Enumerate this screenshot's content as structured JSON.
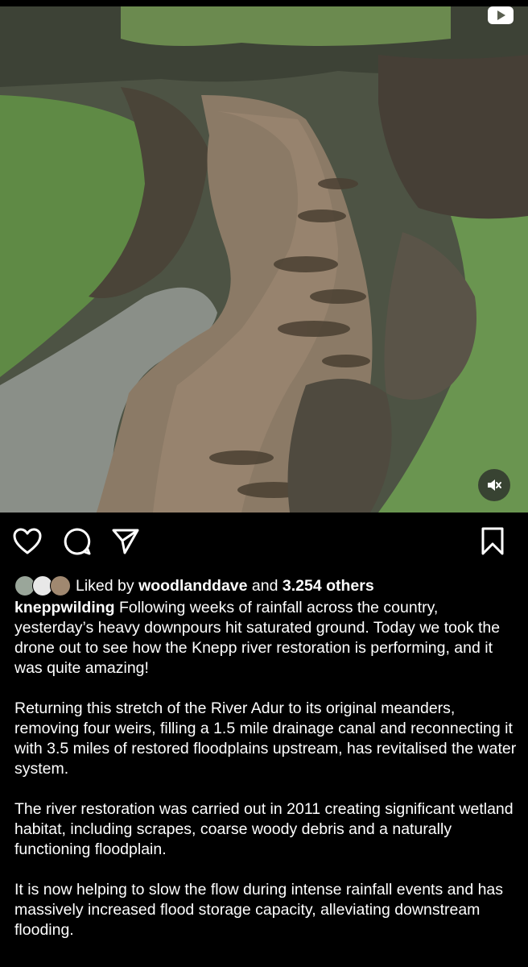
{
  "post": {
    "media": {
      "description_icon": "aerial-flood-photo",
      "video_icon": "video-camera-icon",
      "mute_icon": "speaker-muted-icon"
    },
    "actions": {
      "like_icon": "heart-icon",
      "comment_icon": "comment-icon",
      "share_icon": "send-icon",
      "save_icon": "bookmark-icon"
    },
    "likes": {
      "prefix": "Liked by",
      "user": "woodlanddave",
      "conjunction": "and",
      "others": "3.254 others"
    },
    "caption": {
      "username": "kneppwilding",
      "paragraph_1": "Following weeks of rainfall across the country, yesterday’s heavy downpours hit saturated ground. Today we took the drone out to see how the Knepp river restoration is performing, and it was quite amazing!",
      "paragraph_2": "Returning this stretch of the River Adur to its original meanders, removing four weirs, filling a 1.5 mile drainage canal and reconnecting it with 3.5 miles of restored floodplains upstream, has revitalised the water system.",
      "paragraph_3": "The river restoration was carried out in 2011 creating significant wetland habitat, including scrapes, coarse woody debris and a naturally functioning floodplain.",
      "paragraph_4": "It is now helping to slow the flow during intense rainfall events and has massively increased flood storage capacity, alleviating downstream flooding."
    }
  }
}
